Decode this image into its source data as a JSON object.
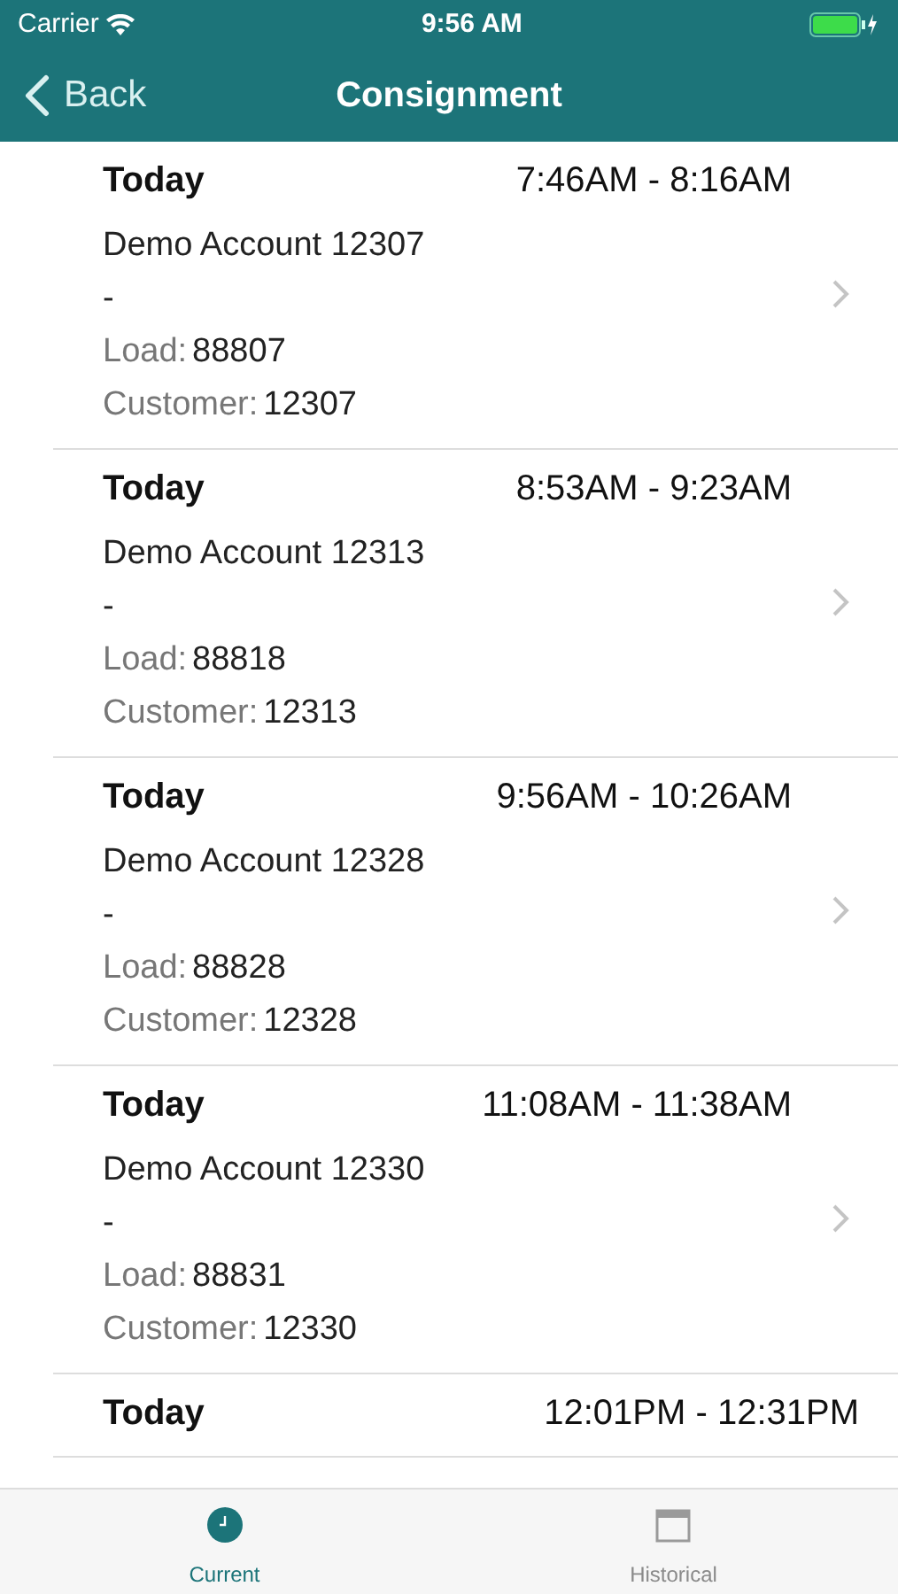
{
  "status_bar": {
    "carrier": "Carrier",
    "time": "9:56 AM"
  },
  "nav": {
    "back": "Back",
    "title": "Consignment"
  },
  "consignments": [
    {
      "day": "Today",
      "window": "7:46AM - 8:16AM",
      "account": "Demo Account 12307",
      "note": "-",
      "load_label": "Load:",
      "load": "88807",
      "customer_label": "Customer:",
      "customer": "12307"
    },
    {
      "day": "Today",
      "window": "8:53AM - 9:23AM",
      "account": "Demo Account 12313",
      "note": "-",
      "load_label": "Load:",
      "load": "88818",
      "customer_label": "Customer:",
      "customer": "12313"
    },
    {
      "day": "Today",
      "window": "9:56AM - 10:26AM",
      "account": "Demo Account 12328",
      "note": "-",
      "load_label": "Load:",
      "load": "88828",
      "customer_label": "Customer:",
      "customer": "12328"
    },
    {
      "day": "Today",
      "window": "11:08AM - 11:38AM",
      "account": "Demo Account 12330",
      "note": "-",
      "load_label": "Load:",
      "load": "88831",
      "customer_label": "Customer:",
      "customer": "12330"
    },
    {
      "day": "Today",
      "window": "12:01PM - 12:31PM"
    }
  ],
  "tabs": [
    {
      "label": "Current",
      "kind": "clock",
      "selected": true
    },
    {
      "label": "Historical",
      "kind": "calendar",
      "selected": false
    }
  ]
}
